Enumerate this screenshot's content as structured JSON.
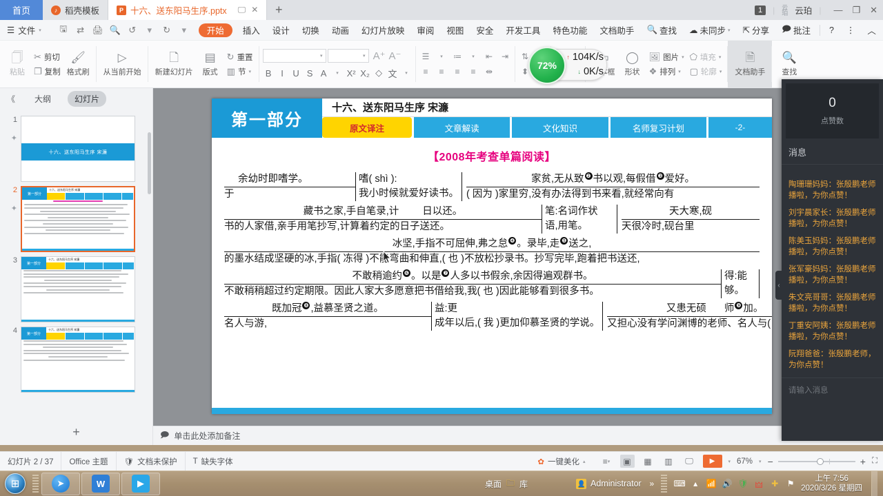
{
  "tabbar": {
    "home_label": "首页",
    "tabs": [
      {
        "label": "稻壳模板",
        "icon": "dao-icon",
        "active": false
      },
      {
        "label": "十六、送东阳马生序.pptx",
        "icon": "ppt-icon",
        "active": true
      }
    ],
    "new_tab_label": "+",
    "badge": "1",
    "account": "云珀",
    "minimize": "—",
    "maximize": "❐",
    "close": "✕"
  },
  "menubar": {
    "file_label": "文件",
    "start_label": "开始",
    "items": [
      "插入",
      "设计",
      "切换",
      "动画",
      "幻灯片放映",
      "审阅",
      "视图",
      "安全",
      "开发工具",
      "特色功能",
      "文档助手"
    ],
    "search_label": "查找",
    "sync_label": "未同步",
    "share_label": "分享",
    "comment_label": "批注",
    "help_label": "?",
    "more_label": "⋮",
    "collapse_label": "︿"
  },
  "ribbon": {
    "paste": "粘贴",
    "cut": "剪切",
    "copy": "复制",
    "format_painter": "格式刷",
    "start_from_current": "从当前开始",
    "new_slide": "新建幻灯片",
    "layout": "版式",
    "section": "节",
    "reset": "重置",
    "font_name": "",
    "font_size": "",
    "font_grow": "A",
    "font_shrink": "A",
    "bold": "B",
    "italic": "I",
    "underline": "U",
    "strike": "S",
    "font_color": "A",
    "superscript": "X²",
    "subscript": "X₂",
    "clear_format": "◇",
    "pinyin": "文",
    "textbox": "文本框",
    "shape": "形状",
    "picture": "图片",
    "arrange": "排列",
    "fill": "填充",
    "outline": "轮廓",
    "doc_assistant": "文档助手",
    "find_replace": "查找"
  },
  "netmon": {
    "percent": "72%",
    "up_speed": "104K/s",
    "down_speed": "0K/s",
    "up_arrow": "↑",
    "down_arrow": "↓"
  },
  "leftpane": {
    "collapse": "《",
    "outline_tab": "大纲",
    "slides_tab": "幻灯片",
    "add_slide": "+",
    "slides": [
      {
        "num": "1",
        "star": "✦",
        "title": "十六、送东阳马生序  宋濂",
        "selected": false
      },
      {
        "num": "2",
        "star": "✦",
        "title": "第一部分",
        "selected": true
      },
      {
        "num": "3",
        "star": "",
        "title": "第一部分",
        "selected": false
      },
      {
        "num": "4",
        "star": "",
        "title": "第一部分",
        "selected": false
      }
    ]
  },
  "slide": {
    "part_label": "第一部分",
    "title": "十六、送东阳马生序 宋濂",
    "tabs": [
      {
        "label": "原文译注",
        "style": "yellow"
      },
      {
        "label": "文章解读",
        "style": "blue"
      },
      {
        "label": "文化知识",
        "style": "blue"
      },
      {
        "label": "名师复习计划",
        "style": "blue"
      }
    ],
    "page_marker": "-2-",
    "exam_title": "【2008年考查单篇阅读】",
    "lines": [
      {
        "id": "l1a",
        "text": "余幼时即嗜学。"
      },
      {
        "id": "l1b",
        "text": "嗜( shì ):"
      },
      {
        "id": "l1c",
        "text": "家贫,无从致"
      },
      {
        "id": "l1d",
        "text": "书以观,每假借"
      },
      {
        "id": "l1e",
        "text": "于"
      },
      {
        "id": "l2a",
        "text": "我小时候就爱好读书。"
      },
      {
        "id": "l2b",
        "text": "爱好。"
      },
      {
        "id": "l2c",
        "text": "( 因为 )家里穷,没有办法得到书来看,就经常向有"
      },
      {
        "id": "l3a",
        "text": "藏书之家,手自笔录,计"
      },
      {
        "id": "l3b",
        "text": "日以还。"
      },
      {
        "id": "l3c",
        "text": "笔:名词作状"
      },
      {
        "id": "l3d",
        "text": "天大寒,砚"
      },
      {
        "id": "l4a",
        "text": "书的人家借,亲手用笔抄写,计算着约定的日子送还。"
      },
      {
        "id": "l4b",
        "text": "语,用笔。"
      },
      {
        "id": "l4c",
        "text": "天很冷时,砚台里"
      },
      {
        "id": "l5a",
        "text": "冰坚,手指不可屈伸,弗之怠"
      },
      {
        "id": "l5b",
        "text": "。录毕,走"
      },
      {
        "id": "l5c",
        "text": "送之,"
      },
      {
        "id": "l6a",
        "text": "的墨水结成坚硬的冰,手指( 冻得 )不能弯曲和伸直,( 也 )不放松抄录书。抄写完毕,跑着把书送还,"
      },
      {
        "id": "l7a",
        "text": "不敢稍逾约"
      },
      {
        "id": "l7b",
        "text": "。以是"
      },
      {
        "id": "l7c",
        "text": "人多以书假余,余因得遍观群书。"
      },
      {
        "id": "l7d",
        "text": "得:能"
      },
      {
        "id": "l8a",
        "text": "不敢稍稍超过约定期限。因此人家大多愿意把书借给我,我( 也 )因此能够看到很多书。"
      },
      {
        "id": "l8b",
        "text": "够。"
      },
      {
        "id": "l9a",
        "text": "既加冠"
      },
      {
        "id": "l9b",
        "text": ",益慕圣贤之道。"
      },
      {
        "id": "l9c",
        "text": "益:更"
      },
      {
        "id": "l9d",
        "text": "又患无硕"
      },
      {
        "id": "l9e",
        "text": "师"
      },
      {
        "id": "l9f",
        "text": "名人与游,"
      },
      {
        "id": "l10a",
        "text": "成年以后,( 我 )更加仰慕圣贤的学说。"
      },
      {
        "id": "l10b",
        "text": "加。"
      },
      {
        "id": "l10c",
        "text": "又担心没有学问渊博的老师、名人与( 自己 )交往,"
      }
    ],
    "marks": {
      "m2": "❷",
      "m3": "❸",
      "m4": "❹",
      "m5": "❺",
      "m6": "❻",
      "m7": "❼",
      "m8": "❽",
      "m9": "❾"
    }
  },
  "notes": {
    "placeholder": "单击此处添加备注"
  },
  "chat": {
    "count": "0",
    "count_label": "点赞数",
    "messages_header": "消息",
    "messages": [
      "陶珊珊妈妈：张殷鹏老师播啦，为你点赞！",
      "刘宇晨家长：张殷鹏老师播啦，为你点赞！",
      "陈美玉妈妈：张殷鹏老师播啦，为你点赞！",
      "张军豪妈妈：张殷鹏老师播啦，为你点赞！",
      "朱文亮哥哥：张殷鹏老师播啦，为你点赞！",
      "丁重安阿姨：张殷鹏老师播啦，为你点赞！",
      "阮翔爸爸：张殷鹏老师，为你点赞！"
    ],
    "input_placeholder": "请输入消息",
    "collapse_arrow": "‹"
  },
  "status": {
    "slide_count": "幻灯片 2 / 37",
    "theme": "Office 主题",
    "protection": "文档未保护",
    "missing_font": "缺失字体",
    "beautify": "一键美化",
    "zoom": "67%",
    "zoom_minus": "−",
    "zoom_plus": "+",
    "fit": "⛶"
  },
  "taskbar": {
    "buttons": [
      "browser-icon",
      "wps-icon",
      "tv-icon"
    ],
    "desktop_label": "桌面",
    "library_label": "库",
    "window_label": "Administrator",
    "overflow": "»",
    "time": "上午 7:56",
    "date": "2020/3/26 星期四"
  }
}
